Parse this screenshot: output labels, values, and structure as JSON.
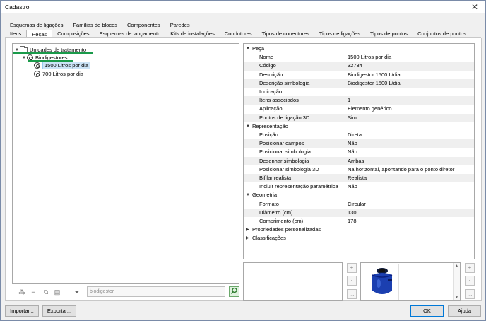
{
  "window": {
    "title": "Cadastro",
    "close_glyph": "✕"
  },
  "tabs_row1": [
    "Esquemas de ligações",
    "Famílias de blocos",
    "Componentes",
    "Paredes"
  ],
  "tabs_row2": [
    "Itens",
    "Peças",
    "Composições",
    "Esquemas de lançamento",
    "Kits de instalações",
    "Condutores",
    "Tipos de conectores",
    "Tipos de ligações",
    "Tipos de pontos",
    "Conjuntos de pontos"
  ],
  "selected_tab": "Peças",
  "tree": {
    "root": "Unidades de tratamento",
    "group": "Biodigestores",
    "items": [
      "1500 Litros por dia",
      "700 Litros por dia"
    ]
  },
  "search": {
    "value": "biodigestor"
  },
  "properties": {
    "sections": [
      {
        "name": "Peça",
        "expanded": true,
        "rows": [
          [
            "Nome",
            "1500 Litros por dia"
          ],
          [
            "Código",
            "32734"
          ],
          [
            "Descrição",
            "Biodigestor 1500 L/dia"
          ],
          [
            "Descrição simbologia",
            "Biodigestor 1500 L/dia"
          ],
          [
            "Indicação",
            ""
          ],
          [
            "Itens associados",
            "1"
          ],
          [
            "Aplicação",
            "Elemento genérico"
          ],
          [
            "Pontos de ligação 3D",
            "Sim"
          ]
        ]
      },
      {
        "name": "Representação",
        "expanded": true,
        "rows": [
          [
            "Posição",
            "Direta"
          ],
          [
            "Posicionar campos",
            "Não"
          ],
          [
            "Posicionar simbologia",
            "Não"
          ],
          [
            "Desenhar simbologia",
            "Ambas"
          ],
          [
            "Posicionar simbologia 3D",
            "Na horizontal, apontando para o ponto diretor"
          ],
          [
            "Bifilar realista",
            "Realista"
          ],
          [
            "Incluir representação paramétrica",
            "Não"
          ]
        ]
      },
      {
        "name": "Geometria",
        "expanded": true,
        "rows": [
          [
            "Formato",
            "Circular"
          ],
          [
            "Diâmetro (cm)",
            "130"
          ],
          [
            "Comprimento (cm)",
            "178"
          ]
        ]
      },
      {
        "name": "Propriedades personalizadas",
        "expanded": false,
        "rows": []
      },
      {
        "name": "Classificações",
        "expanded": false,
        "rows": []
      }
    ]
  },
  "side_buttons": {
    "add": "+",
    "remove": "-",
    "more": "..."
  },
  "buttons": {
    "import": "Importar...",
    "export": "Exportar...",
    "ok": "OK",
    "help": "Ajuda"
  },
  "colors": {
    "accent_underline": "#1a9a4a",
    "selection": "#cce4f7",
    "thumbnail_blue": "#1b3fb0"
  }
}
